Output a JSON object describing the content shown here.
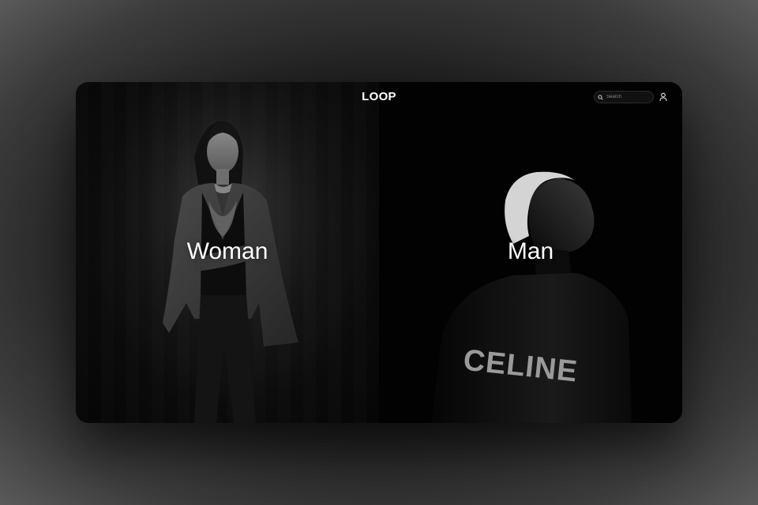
{
  "header": {
    "logo": "LOOP",
    "search": {
      "placeholder": "Search"
    }
  },
  "panels": [
    {
      "label": "Woman",
      "photo": "woman-portrait"
    },
    {
      "label": "Man",
      "photo": "man-portrait",
      "shirt_print": "CELINE"
    }
  ],
  "colors": {
    "background": "#000000",
    "text": "#ffffff"
  },
  "icons": [
    "search-icon",
    "user-icon"
  ]
}
